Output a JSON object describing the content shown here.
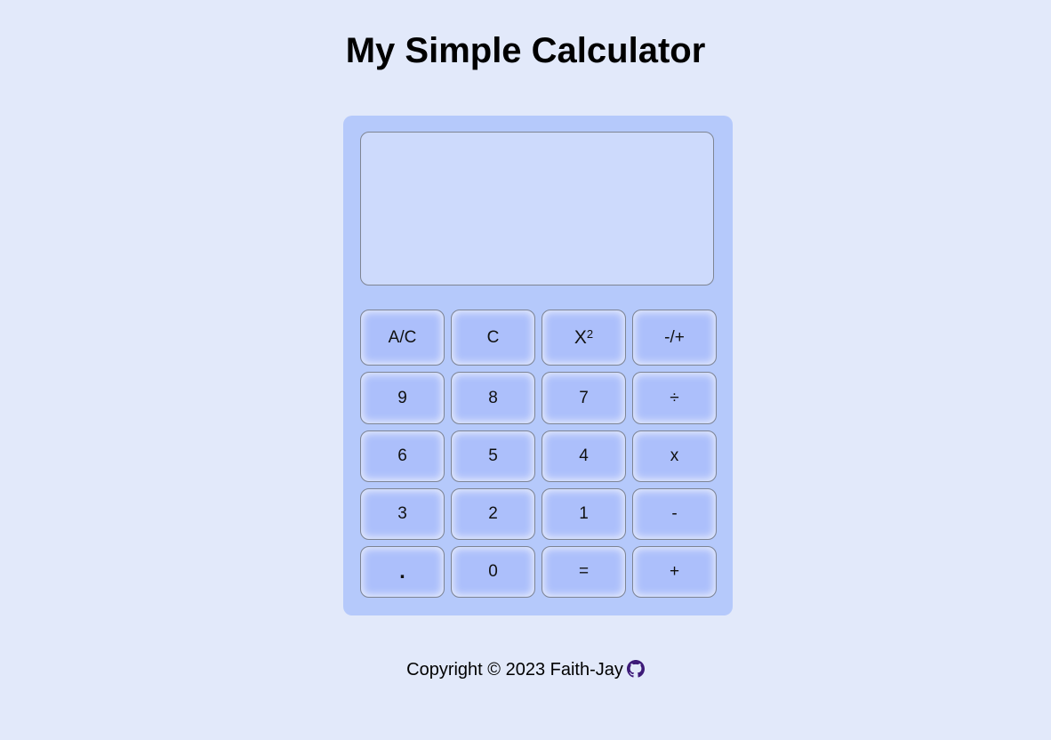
{
  "page": {
    "title": "My Simple Calculator"
  },
  "display": {
    "value": ""
  },
  "keys": [
    [
      "A/C",
      "C",
      "X2",
      "-/+"
    ],
    [
      "9",
      "8",
      "7",
      "÷"
    ],
    [
      "6",
      "5",
      "4",
      "x"
    ],
    [
      "3",
      "2",
      "1",
      "-"
    ],
    [
      ".",
      "0",
      "=",
      "+"
    ]
  ],
  "square_key": {
    "base": "X",
    "exponent": "2"
  },
  "footer": {
    "text": "Copyright © 2023 Faith-Jay",
    "icon": "github-icon",
    "icon_color": "#3d1a78"
  },
  "colors": {
    "page_bg": "#e2e9fa",
    "calculator_bg": "#b5c9fb",
    "display_bg": "#cddafc",
    "key_bg": "#acbffb"
  }
}
